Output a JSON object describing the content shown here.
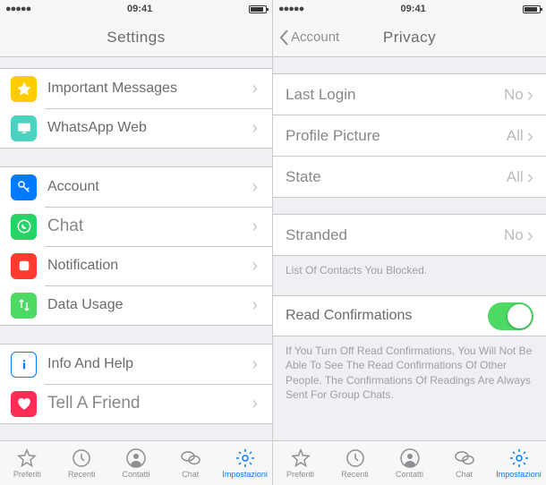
{
  "statusbar": {
    "time": "09:41"
  },
  "left": {
    "title": "Settings",
    "groups": [
      [
        {
          "label": "Important Messages",
          "icon": "star-icon",
          "color": "yellow"
        },
        {
          "label": "WhatsApp Web",
          "icon": "computer-icon",
          "color": "teal"
        }
      ],
      [
        {
          "label": "Account",
          "icon": "key-icon",
          "color": "blue-key"
        },
        {
          "label": "Chat",
          "icon": "whatsapp-icon",
          "color": "green",
          "big": true
        },
        {
          "label": "Notification",
          "icon": "app-icon",
          "color": "red"
        },
        {
          "label": "Data Usage",
          "icon": "arrows-icon",
          "color": "arrows"
        }
      ],
      [
        {
          "label": "Info And Help",
          "icon": "info-icon",
          "color": "info"
        },
        {
          "label": "Tell A Friend",
          "icon": "heart-icon",
          "color": "heart",
          "big": true
        }
      ]
    ]
  },
  "right": {
    "back": "Account",
    "title": "Privacy",
    "rows1": [
      {
        "label": "Last Login",
        "value": "No"
      },
      {
        "label": "Profile Picture",
        "value": "All"
      },
      {
        "label": "State",
        "value": "All"
      }
    ],
    "rows2": [
      {
        "label": "Stranded",
        "value": "No"
      }
    ],
    "blockedText": "List Of Contacts You Blocked.",
    "toggle": {
      "label": "Read Confirmations",
      "on": true
    },
    "explainText": "If You Turn Off Read Confirmations, You Will Not Be Able To See The Read Confirmations Of Other People. The Confirmations Of Readings Are Always Sent For Group Chats."
  },
  "tabs": [
    {
      "label": "Preferiti",
      "icon": "star-outline-icon"
    },
    {
      "label": "Recenti",
      "icon": "clock-icon"
    },
    {
      "label": "Contatti",
      "icon": "contact-icon"
    },
    {
      "label": "Chat",
      "icon": "chat-bubbles-icon"
    },
    {
      "label": "Impostazioni",
      "icon": "gear-icon",
      "active": true
    }
  ]
}
